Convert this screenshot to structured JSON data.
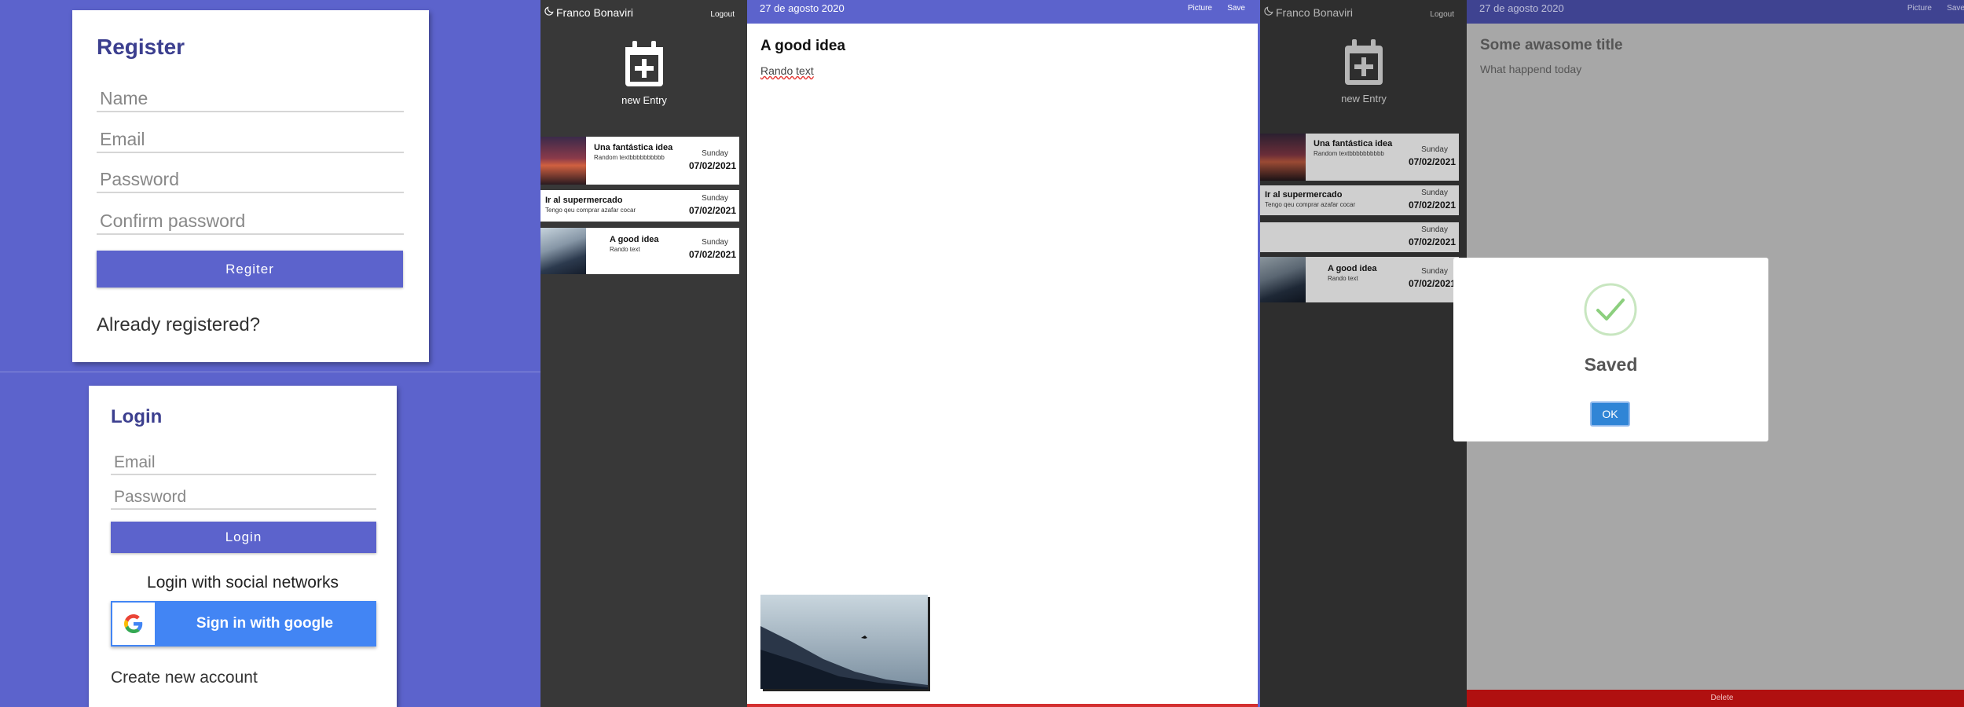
{
  "register": {
    "title": "Register",
    "name_placeholder": "Name",
    "email_placeholder": "Email",
    "password_placeholder": "Password",
    "confirm_placeholder": "Confirm password",
    "submit_label": "Regiter",
    "already_link": "Already registered?"
  },
  "login": {
    "title": "Login",
    "email_placeholder": "Email",
    "password_placeholder": "Password",
    "submit_label": "Login",
    "social_heading": "Login with social networks",
    "google_label": "Sign in with google",
    "create_link": "Create new account"
  },
  "sidebar": {
    "user_name": "Franco Bonaviri",
    "logout_label": "Logout",
    "new_entry_label": "new Entry",
    "user_icon": "moon-icon",
    "new_entry_icon": "calendar-plus-icon"
  },
  "entries_a": [
    {
      "title": "Una fantástica idea",
      "subtitle": "Random textbbbbbbbbbb",
      "day": "Sunday",
      "date": "07/02/2021"
    },
    {
      "title": "Ir al supermercado",
      "subtitle": "Tengo qeu comprar azafar cocar",
      "day": "Sunday",
      "date": "07/02/2021"
    },
    {
      "title": "A good idea",
      "subtitle": "Rando text",
      "day": "Sunday",
      "date": "07/02/2021"
    }
  ],
  "entries_b": [
    {
      "title": "Una fantástica idea",
      "subtitle": "Random textbbbbbbbbbb",
      "day": "Sunday",
      "date": "07/02/2021"
    },
    {
      "title": "Ir al supermercado",
      "subtitle": "Tengo qeu comprar azafar cocar",
      "day": "Sunday",
      "date": "07/02/2021"
    },
    {
      "title": "",
      "subtitle": "",
      "day": "Sunday",
      "date": "07/02/2021"
    },
    {
      "title": "A good idea",
      "subtitle": "Rando text",
      "day": "Sunday",
      "date": "07/02/2021"
    }
  ],
  "editor_a": {
    "date": "27 de agosto 2020",
    "picture_label": "Picture",
    "save_label": "Save",
    "title": "A good idea",
    "body": "Rando text"
  },
  "editor_b": {
    "date": "27 de agosto 2020",
    "picture_label": "Picture",
    "save_label": "Save",
    "title_placeholder": "Some awasome title",
    "body_placeholder": "What happend today",
    "delete_label": "Delete"
  },
  "modal": {
    "title": "Saved",
    "ok_label": "OK",
    "icon": "check-circle-icon"
  },
  "colors": {
    "brand": "#5c63cc",
    "sidebar": "#383838",
    "google": "#4285f4",
    "modal_button": "#3085d6",
    "danger": "#d32f2f"
  }
}
